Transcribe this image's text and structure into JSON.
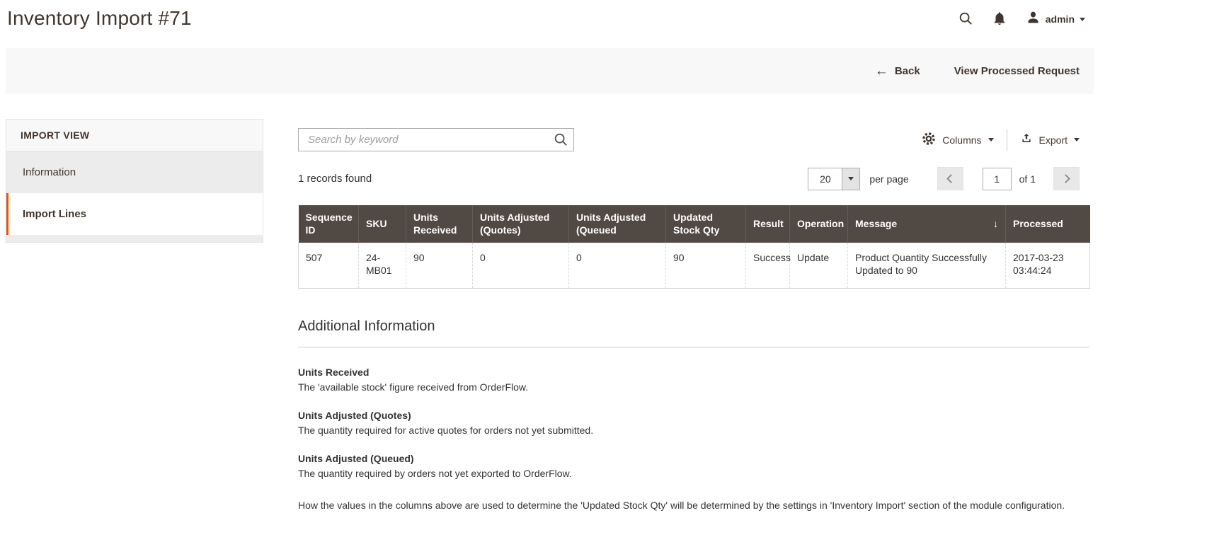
{
  "header": {
    "title": "Inventory Import #71",
    "user": "admin"
  },
  "actions": {
    "back_label": "Back",
    "view_processed_label": "View Processed Request"
  },
  "sidebar": {
    "title": "IMPORT VIEW",
    "items": [
      {
        "label": "Information",
        "active": false
      },
      {
        "label": "Import Lines",
        "active": true
      }
    ]
  },
  "grid": {
    "search_placeholder": "Search by keyword",
    "columns_label": "Columns",
    "export_label": "Export",
    "records_found": "1 records found",
    "pagination": {
      "per_page_value": "20",
      "per_page_label": "per page",
      "page_value": "1",
      "of_label": "of 1"
    },
    "table": {
      "headers": [
        "Sequence ID",
        "SKU",
        "Units Received",
        "Units Adjusted (Quotes)",
        "Units Adjusted (Queued",
        "Updated Stock Qty",
        "Result",
        "Operation",
        "Message",
        "Processed"
      ],
      "sorted_column": "Message",
      "rows": [
        [
          "507",
          "24-MB01",
          "90",
          "0",
          "0",
          "90",
          "Success",
          "Update",
          "Product Quantity Successfully Updated to 90",
          "2017-03-23 03:44:24"
        ]
      ]
    }
  },
  "additional_info": {
    "title": "Additional Information",
    "entries": [
      {
        "term": "Units Received",
        "description": "The 'available stock' figure received from OrderFlow."
      },
      {
        "term": "Units Adjusted (Quotes)",
        "description": "The quantity required for active quotes for orders not yet submitted."
      },
      {
        "term": "Units Adjusted (Queued)",
        "description": "The quantity required by orders not yet exported to OrderFlow."
      }
    ],
    "footnote": "How the values in the columns above are used to determine the 'Updated Stock Qty' will be determined by the settings in 'Inventory Import' section of the module configuration."
  },
  "icons": {
    "back_arrow": "←",
    "sort_desc": "↓"
  },
  "colors": {
    "accent": "#eb5202",
    "table_header_bg": "#514943",
    "text": "#41362f",
    "action_bar_bg": "#f8f8f8"
  }
}
